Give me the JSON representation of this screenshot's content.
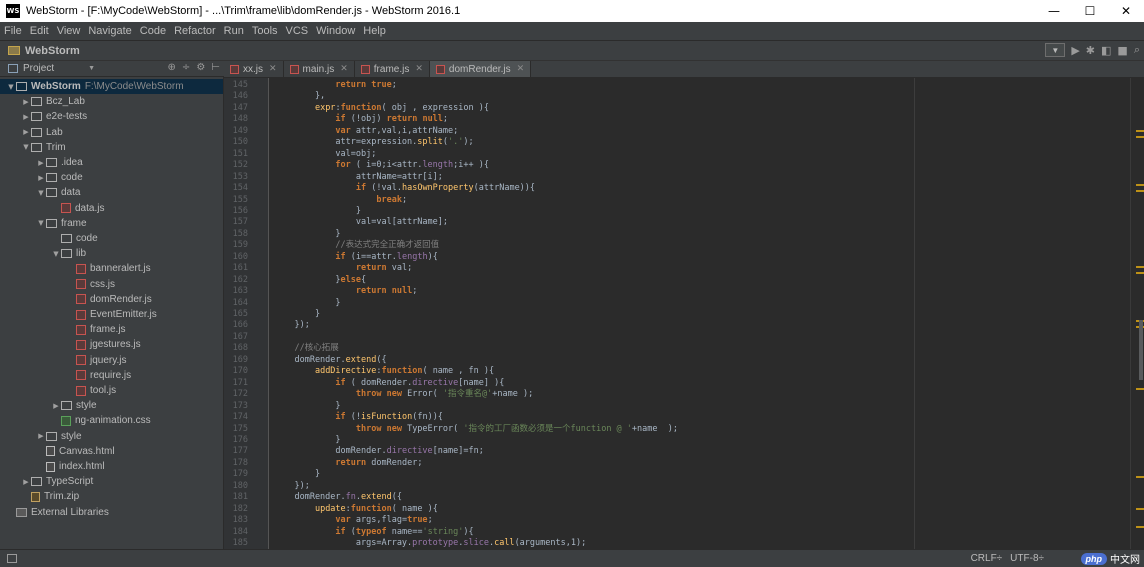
{
  "window": {
    "app_icon": "WS",
    "title": "WebStorm - [F:\\MyCode\\WebStorm] - ...\\Trim\\frame\\lib\\domRender.js - WebStorm 2016.1",
    "controls": [
      "—",
      "☐",
      "✕"
    ]
  },
  "menu": {
    "items": [
      "File",
      "Edit",
      "View",
      "Navigate",
      "Code",
      "Refactor",
      "Run",
      "Tools",
      "VCS",
      "Window",
      "Help"
    ]
  },
  "navbar": {
    "title": "WebStorm",
    "icons": [
      "dropdown-icon",
      "run-icon",
      "debug-icon",
      "coverage-icon",
      "stop-icon",
      "search-icon"
    ]
  },
  "project_panel": {
    "label": "Project",
    "tree": [
      {
        "label": "WebStorm",
        "path": "F:\\MyCode\\WebStorm",
        "depth": 0,
        "type": "folder",
        "expanded": true,
        "selected": true
      },
      {
        "label": "Bcz_Lab",
        "depth": 1,
        "type": "folder",
        "expanded": false
      },
      {
        "label": "e2e-tests",
        "depth": 1,
        "type": "folder",
        "expanded": false
      },
      {
        "label": "Lab",
        "depth": 1,
        "type": "folder",
        "expanded": false
      },
      {
        "label": "Trim",
        "depth": 1,
        "type": "folder",
        "expanded": true
      },
      {
        "label": ".idea",
        "depth": 2,
        "type": "folder",
        "expanded": false
      },
      {
        "label": "code",
        "depth": 2,
        "type": "folder",
        "expanded": false
      },
      {
        "label": "data",
        "depth": 2,
        "type": "folder",
        "expanded": true
      },
      {
        "label": "data.js",
        "depth": 3,
        "type": "js"
      },
      {
        "label": "frame",
        "depth": 2,
        "type": "folder",
        "expanded": true
      },
      {
        "label": "code",
        "depth": 3,
        "type": "folder",
        "leaf": true
      },
      {
        "label": "lib",
        "depth": 3,
        "type": "folder",
        "expanded": true
      },
      {
        "label": "banneralert.js",
        "depth": 4,
        "type": "js"
      },
      {
        "label": "css.js",
        "depth": 4,
        "type": "js"
      },
      {
        "label": "domRender.js",
        "depth": 4,
        "type": "js"
      },
      {
        "label": "EventEmitter.js",
        "depth": 4,
        "type": "js"
      },
      {
        "label": "frame.js",
        "depth": 4,
        "type": "js"
      },
      {
        "label": "jgestures.js",
        "depth": 4,
        "type": "js"
      },
      {
        "label": "jquery.js",
        "depth": 4,
        "type": "js"
      },
      {
        "label": "require.js",
        "depth": 4,
        "type": "js"
      },
      {
        "label": "tool.js",
        "depth": 4,
        "type": "js"
      },
      {
        "label": "style",
        "depth": 3,
        "type": "folder",
        "expanded": false
      },
      {
        "label": "ng-animation.css",
        "depth": 3,
        "type": "css"
      },
      {
        "label": "style",
        "depth": 2,
        "type": "folder",
        "expanded": false
      },
      {
        "label": "Canvas.html",
        "depth": 2,
        "type": "html"
      },
      {
        "label": "index.html",
        "depth": 2,
        "type": "html"
      },
      {
        "label": "TypeScript",
        "depth": 1,
        "type": "folder",
        "expanded": false
      },
      {
        "label": "Trim.zip",
        "depth": 1,
        "type": "zip"
      },
      {
        "label": "External Libraries",
        "depth": 0,
        "type": "lib"
      }
    ]
  },
  "tabs": [
    {
      "label": "xx.js",
      "active": false
    },
    {
      "label": "main.js",
      "active": false
    },
    {
      "label": "frame.js",
      "active": false
    },
    {
      "label": "domRender.js",
      "active": true
    }
  ],
  "editor": {
    "lines": [
      {
        "n": "145",
        "c": [
          [
            "plain",
            "            "
          ],
          [
            "kw",
            "return true"
          ],
          [
            "plain",
            ";"
          ]
        ]
      },
      {
        "n": "146",
        "c": [
          [
            "plain",
            "        },"
          ]
        ]
      },
      {
        "n": "147",
        "c": [
          [
            "plain",
            "        "
          ],
          [
            "fn",
            "expr"
          ],
          [
            "plain",
            ":"
          ],
          [
            "kw",
            "function"
          ],
          [
            "plain",
            "( obj , expression ){"
          ]
        ]
      },
      {
        "n": "148",
        "c": [
          [
            "plain",
            "            "
          ],
          [
            "kw",
            "if"
          ],
          [
            "plain",
            " (!obj) "
          ],
          [
            "kw",
            "return null"
          ],
          [
            "plain",
            ";"
          ]
        ]
      },
      {
        "n": "149",
        "c": [
          [
            "plain",
            "            "
          ],
          [
            "kw",
            "var"
          ],
          [
            "plain",
            " attr,val,i,attrName;"
          ]
        ]
      },
      {
        "n": "150",
        "c": [
          [
            "plain",
            "            attr=expression."
          ],
          [
            "fn",
            "split"
          ],
          [
            "plain",
            "("
          ],
          [
            "str",
            "'.'"
          ],
          [
            "plain",
            ");"
          ]
        ]
      },
      {
        "n": "151",
        "c": [
          [
            "plain",
            "            val=obj;"
          ]
        ]
      },
      {
        "n": "152",
        "c": [
          [
            "plain",
            "            "
          ],
          [
            "kw",
            "for"
          ],
          [
            "plain",
            " ( i=0;i<attr."
          ],
          [
            "prop",
            "length"
          ],
          [
            "plain",
            ";i++ ){"
          ]
        ]
      },
      {
        "n": "153",
        "c": [
          [
            "plain",
            "                attrName=attr[i];"
          ]
        ]
      },
      {
        "n": "154",
        "c": [
          [
            "plain",
            "                "
          ],
          [
            "kw",
            "if"
          ],
          [
            "plain",
            " (!val."
          ],
          [
            "fn",
            "hasOwnProperty"
          ],
          [
            "plain",
            "(attrName)){"
          ]
        ]
      },
      {
        "n": "155",
        "c": [
          [
            "plain",
            "                    "
          ],
          [
            "kw",
            "break"
          ],
          [
            "plain",
            ";"
          ]
        ]
      },
      {
        "n": "156",
        "c": [
          [
            "plain",
            "                }"
          ]
        ]
      },
      {
        "n": "157",
        "c": [
          [
            "plain",
            "                val=val[attrName];"
          ]
        ]
      },
      {
        "n": "158",
        "c": [
          [
            "plain",
            "            }"
          ]
        ]
      },
      {
        "n": "159",
        "c": [
          [
            "cmt",
            "            //表达式完全正确才返回值"
          ]
        ]
      },
      {
        "n": "160",
        "c": [
          [
            "plain",
            "            "
          ],
          [
            "kw",
            "if"
          ],
          [
            "plain",
            " (i==attr."
          ],
          [
            "prop",
            "length"
          ],
          [
            "plain",
            "){"
          ]
        ]
      },
      {
        "n": "161",
        "c": [
          [
            "plain",
            "                "
          ],
          [
            "kw",
            "return"
          ],
          [
            "plain",
            " val;"
          ]
        ]
      },
      {
        "n": "162",
        "c": [
          [
            "plain",
            "            }"
          ],
          [
            "kw",
            "else"
          ],
          [
            "plain",
            "{"
          ]
        ]
      },
      {
        "n": "163",
        "c": [
          [
            "plain",
            "                "
          ],
          [
            "kw",
            "return null"
          ],
          [
            "plain",
            ";"
          ]
        ]
      },
      {
        "n": "164",
        "c": [
          [
            "plain",
            "            }"
          ]
        ]
      },
      {
        "n": "165",
        "c": [
          [
            "plain",
            "        }"
          ]
        ]
      },
      {
        "n": "166",
        "c": [
          [
            "plain",
            "    });"
          ]
        ]
      },
      {
        "n": "167",
        "c": [
          [
            "plain",
            ""
          ]
        ]
      },
      {
        "n": "168",
        "c": [
          [
            "cmt",
            "    //核心拓展"
          ]
        ]
      },
      {
        "n": "169",
        "c": [
          [
            "plain",
            "    domRender."
          ],
          [
            "fn",
            "extend"
          ],
          [
            "plain",
            "({"
          ]
        ]
      },
      {
        "n": "170",
        "c": [
          [
            "plain",
            "        "
          ],
          [
            "fn",
            "addDirective"
          ],
          [
            "plain",
            ":"
          ],
          [
            "kw",
            "function"
          ],
          [
            "plain",
            "( name , fn ){"
          ]
        ]
      },
      {
        "n": "171",
        "c": [
          [
            "plain",
            "            "
          ],
          [
            "kw",
            "if"
          ],
          [
            "plain",
            " ( domRender."
          ],
          [
            "prop",
            "directive"
          ],
          [
            "plain",
            "[name] ){"
          ]
        ]
      },
      {
        "n": "172",
        "c": [
          [
            "plain",
            "                "
          ],
          [
            "kw",
            "throw new"
          ],
          [
            "plain",
            " Error( "
          ],
          [
            "str",
            "'指令重名@'"
          ],
          [
            "plain",
            "+name );"
          ]
        ]
      },
      {
        "n": "173",
        "c": [
          [
            "plain",
            "            }"
          ]
        ]
      },
      {
        "n": "174",
        "c": [
          [
            "plain",
            "            "
          ],
          [
            "kw",
            "if"
          ],
          [
            "plain",
            " (!"
          ],
          [
            "fn",
            "isFunction"
          ],
          [
            "plain",
            "(fn)){"
          ]
        ]
      },
      {
        "n": "175",
        "c": [
          [
            "plain",
            "                "
          ],
          [
            "kw",
            "throw new"
          ],
          [
            "plain",
            " TypeError( "
          ],
          [
            "str",
            "'指令的工厂函数必须是一个function @ '"
          ],
          [
            "plain",
            "+name  );"
          ]
        ]
      },
      {
        "n": "176",
        "c": [
          [
            "plain",
            "            }"
          ]
        ]
      },
      {
        "n": "177",
        "c": [
          [
            "plain",
            "            domRender."
          ],
          [
            "prop",
            "directive"
          ],
          [
            "plain",
            "[name]=fn;"
          ]
        ]
      },
      {
        "n": "178",
        "c": [
          [
            "plain",
            "            "
          ],
          [
            "kw",
            "return"
          ],
          [
            "plain",
            " domRender;"
          ]
        ]
      },
      {
        "n": "179",
        "c": [
          [
            "plain",
            "        }"
          ]
        ]
      },
      {
        "n": "180",
        "c": [
          [
            "plain",
            "    });"
          ]
        ]
      },
      {
        "n": "181",
        "c": [
          [
            "plain",
            "    domRender."
          ],
          [
            "prop",
            "fn"
          ],
          [
            "plain",
            "."
          ],
          [
            "fn",
            "extend"
          ],
          [
            "plain",
            "({"
          ]
        ]
      },
      {
        "n": "182",
        "c": [
          [
            "plain",
            "        "
          ],
          [
            "fn",
            "update"
          ],
          [
            "plain",
            ":"
          ],
          [
            "kw",
            "function"
          ],
          [
            "plain",
            "( name ){"
          ]
        ]
      },
      {
        "n": "183",
        "c": [
          [
            "plain",
            "            "
          ],
          [
            "kw",
            "var"
          ],
          [
            "plain",
            " args,flag="
          ],
          [
            "kw",
            "true"
          ],
          [
            "plain",
            ";"
          ]
        ]
      },
      {
        "n": "184",
        "c": [
          [
            "plain",
            "            "
          ],
          [
            "kw",
            "if"
          ],
          [
            "plain",
            " ("
          ],
          [
            "kw",
            "typeof"
          ],
          [
            "plain",
            " name=="
          ],
          [
            "str",
            "'string'"
          ],
          [
            "plain",
            "){"
          ]
        ]
      },
      {
        "n": "185",
        "c": [
          [
            "plain",
            "                args=Array."
          ],
          [
            "prop",
            "prototype"
          ],
          [
            "plain",
            "."
          ],
          [
            "prop",
            "slice"
          ],
          [
            "plain",
            "."
          ],
          [
            "fn",
            "call"
          ],
          [
            "plain",
            "(arguments,1);"
          ]
        ]
      }
    ]
  },
  "status": {
    "line_sep": "CRLF÷",
    "encoding": "UTF-8÷",
    "watermark_logo": "php",
    "watermark_text": "中文网"
  },
  "colors": {
    "editor_bg": "#2b2b2b",
    "panel_bg": "#3c3f41",
    "selection": "#0d293e",
    "keyword": "#cc7832",
    "function": "#ffc66d",
    "string": "#6a8759",
    "comment": "#808080"
  }
}
